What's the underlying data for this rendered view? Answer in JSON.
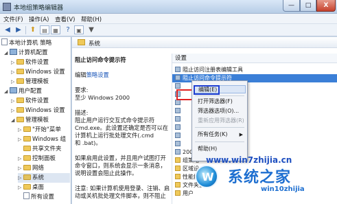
{
  "window": {
    "title": "本地组策略编辑器",
    "minimize": "—",
    "maximize": "□",
    "close": "X"
  },
  "menu": [
    "文件(F)",
    "操作(A)",
    "查看(V)",
    "帮助(H)"
  ],
  "tree": {
    "root": "本地计算机 策略",
    "items": [
      "计算机配置",
      "软件设置",
      "Windows 设置",
      "管理模板",
      "用户配置",
      "软件设置",
      "Windows 设置",
      "管理模板",
      "\"开始\"菜单",
      "Windows 组",
      "共享文件夹",
      "控制面板",
      "网络",
      "系统",
      "桌面",
      "所有设置"
    ]
  },
  "breadcrumb_header": "系统",
  "details": {
    "title": "阻止访问命令提示符",
    "edit_prefix": "编辑",
    "edit_link": "策略设置",
    "req_label": "要求:",
    "req_value": "至少 Windows 2000",
    "desc_label": "描述:",
    "desc_lines": [
      "阻止用户运行交互式命令提示符",
      "Cmd.exe。此设置还确定是否可以在",
      "计算机上运行批处理文件(.cmd",
      "和 .bat)。"
    ],
    "note_lines": [
      "如果启用此设置，并且用户试图打开",
      "命令窗口，则系统会显示一条消息，",
      "说明设置会阻止此操作。"
    ],
    "note2_lines": [
      "注意: 如果计算机使用登录、注销、启",
      "动或关机批处理文件脚本，则不阻止"
    ]
  },
  "list": {
    "column": "设置",
    "items": [
      "阻止访问注册表编辑工具",
      "阻止访问命令提示符",
      "",
      "",
      "",
      "",
      "",
      "",
      "",
      "",
      "2000 年",
      "组策略",
      "区域设",
      "性能控制",
      "文件夹重",
      "用户"
    ]
  },
  "context_menu": {
    "items": [
      {
        "label": "编辑(E)",
        "hot": true
      },
      {
        "label": "打开筛选器(F)"
      },
      {
        "label": "筛选器选项(O)..."
      },
      {
        "label": "重新应用筛选器(R)",
        "disabled": true
      },
      {
        "label": "所有任务(K)",
        "submenu": "▶"
      },
      {
        "label": "帮助(H)"
      }
    ]
  },
  "watermark": {
    "url": "www.win7zhijia.cn",
    "logo_letter": "W",
    "brand": "系统之家",
    "small": "win10zhijia"
  }
}
